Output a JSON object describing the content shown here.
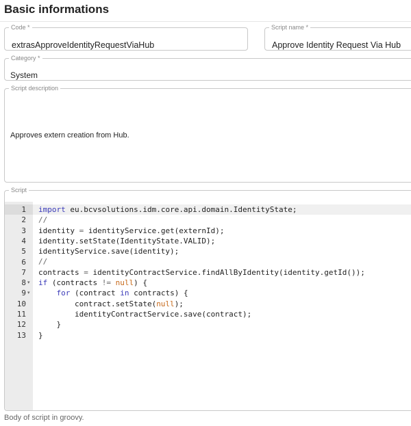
{
  "section": {
    "title": "Basic informations"
  },
  "fields": {
    "code": {
      "label": "Code *",
      "value": "extrasApproveIdentityRequestViaHub"
    },
    "script_name": {
      "label": "Script name *",
      "value": "Approve Identity Request Via Hub"
    },
    "category": {
      "label": "Category *",
      "value": "System"
    },
    "description": {
      "label": "Script description",
      "value": "Approves extern creation from Hub."
    }
  },
  "script": {
    "label": "Script",
    "helper_text": "Body of script in groovy.",
    "active_line": 1,
    "lines": [
      {
        "n": "1",
        "fold": "",
        "tokens": [
          {
            "t": "import",
            "c": "kw"
          },
          {
            "t": " eu.bcvsolutions.idm.core.api.domain.IdentityState;",
            "c": ""
          }
        ]
      },
      {
        "n": "2",
        "fold": "",
        "tokens": [
          {
            "t": "//",
            "c": "cm"
          }
        ]
      },
      {
        "n": "3",
        "fold": "",
        "tokens": [
          {
            "t": "identity ",
            "c": ""
          },
          {
            "t": "=",
            "c": "op"
          },
          {
            "t": " identityService.get(externId);",
            "c": ""
          }
        ]
      },
      {
        "n": "4",
        "fold": "",
        "tokens": [
          {
            "t": "identity.setState(IdentityState.VALID);",
            "c": ""
          }
        ]
      },
      {
        "n": "5",
        "fold": "",
        "tokens": [
          {
            "t": "identityService.save(identity);",
            "c": ""
          }
        ]
      },
      {
        "n": "6",
        "fold": "",
        "tokens": [
          {
            "t": "//",
            "c": "cm"
          }
        ]
      },
      {
        "n": "7",
        "fold": "",
        "tokens": [
          {
            "t": "contracts ",
            "c": ""
          },
          {
            "t": "=",
            "c": "op"
          },
          {
            "t": " identityContractService.findAllByIdentity(identity.getId());",
            "c": ""
          }
        ]
      },
      {
        "n": "8",
        "fold": "▾",
        "tokens": [
          {
            "t": "if",
            "c": "kw"
          },
          {
            "t": " (contracts ",
            "c": ""
          },
          {
            "t": "!=",
            "c": "op"
          },
          {
            "t": " ",
            "c": ""
          },
          {
            "t": "null",
            "c": "lit"
          },
          {
            "t": ") {",
            "c": ""
          }
        ]
      },
      {
        "n": "9",
        "fold": "▾",
        "tokens": [
          {
            "t": "    ",
            "c": ""
          },
          {
            "t": "for",
            "c": "kw"
          },
          {
            "t": " (contract ",
            "c": ""
          },
          {
            "t": "in",
            "c": "kw"
          },
          {
            "t": " contracts) {",
            "c": ""
          }
        ]
      },
      {
        "n": "10",
        "fold": "",
        "tokens": [
          {
            "t": "        contract.setState(",
            "c": ""
          },
          {
            "t": "null",
            "c": "lit"
          },
          {
            "t": ");",
            "c": ""
          }
        ]
      },
      {
        "n": "11",
        "fold": "",
        "tokens": [
          {
            "t": "        identityContractService.save(contract);",
            "c": ""
          }
        ]
      },
      {
        "n": "12",
        "fold": "",
        "tokens": [
          {
            "t": "    }",
            "c": ""
          }
        ]
      },
      {
        "n": "13",
        "fold": "",
        "tokens": [
          {
            "t": "}",
            "c": ""
          }
        ]
      }
    ]
  }
}
